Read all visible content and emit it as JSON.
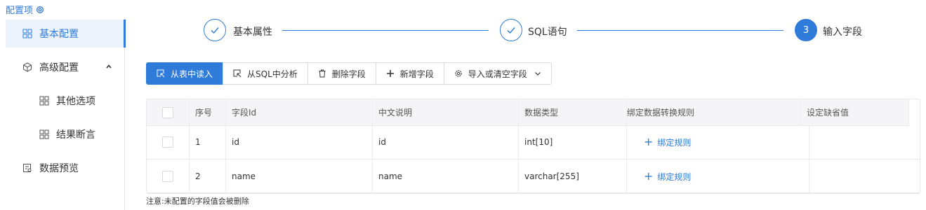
{
  "header": {
    "title": "配置项",
    "icon": "settings-icon"
  },
  "sidebar": {
    "items": [
      {
        "label": "基本配置",
        "icon": "grid-icon",
        "active": true
      },
      {
        "label": "高级配置",
        "icon": "cube-icon",
        "expanded": true
      },
      {
        "label": "其他选项",
        "icon": "grid-icon"
      },
      {
        "label": "结果断言",
        "icon": "grid-icon"
      },
      {
        "label": "数据预览",
        "icon": "preview-icon"
      }
    ]
  },
  "steps": [
    {
      "label": "基本属性",
      "status": "done"
    },
    {
      "label": "SQL语句",
      "status": "done"
    },
    {
      "label": "输入字段",
      "number": "3",
      "status": "current"
    }
  ],
  "toolbar": {
    "from_table": "从表中读入",
    "from_sql": "从SQL中分析",
    "delete_field": "删除字段",
    "add_field": "新增字段",
    "import_clear": "导入或清空字段"
  },
  "table": {
    "columns": [
      "",
      "序号",
      "字段Id",
      "中文说明",
      "数据类型",
      "绑定数据转换规则",
      "设定缺省值"
    ],
    "rows": [
      {
        "index": "1",
        "field_id": "id",
        "desc": "id",
        "type": "int[10]",
        "rule": "绑定规则",
        "default": ""
      },
      {
        "index": "2",
        "field_id": "name",
        "desc": "name",
        "type": "varchar[255]",
        "rule": "绑定规则",
        "default": ""
      }
    ]
  },
  "note": "注意:未配置的字段值会被删除",
  "colors": {
    "accent": "#2f7bd9",
    "active_bg": "#eef4fd",
    "header_bg": "#f5f5f7"
  }
}
